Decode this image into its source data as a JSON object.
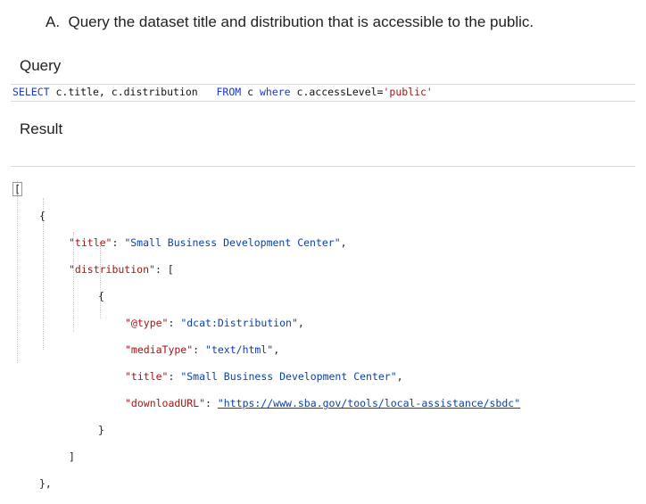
{
  "heading": "A.  Query the dataset title and distribution that is accessible to the public.",
  "query_label": "Query",
  "query": {
    "select_kw": "SELECT",
    "fields": " c.title, c.distribution",
    "from_kw": "FROM",
    "alias": " c ",
    "where_kw": "where",
    "condition": " c.accessLevel=",
    "value": "'public'"
  },
  "result_label": "Result",
  "result": {
    "open_bracket": "[",
    "open_brace": "{",
    "title_key": "\"title\"",
    "title_value": "\"Small Business Development Center\"",
    "distribution_key": "\"distribution\"",
    "dist_open": "[",
    "item_open": "{",
    "type_key": "\"@type\"",
    "type_value": "\"dcat:Distribution\"",
    "media_key": "\"mediaType\"",
    "media_value": "\"text/html\"",
    "title2_key": "\"title\"",
    "title2_value": "\"Small Business Development Center\"",
    "download_key": "\"downloadURL\"",
    "download_value": "\"https://www.sba.gov/tools/local-assistance/sbdc\"",
    "item_close": "}",
    "dist_close": "]",
    "close_brace": "},"
  }
}
